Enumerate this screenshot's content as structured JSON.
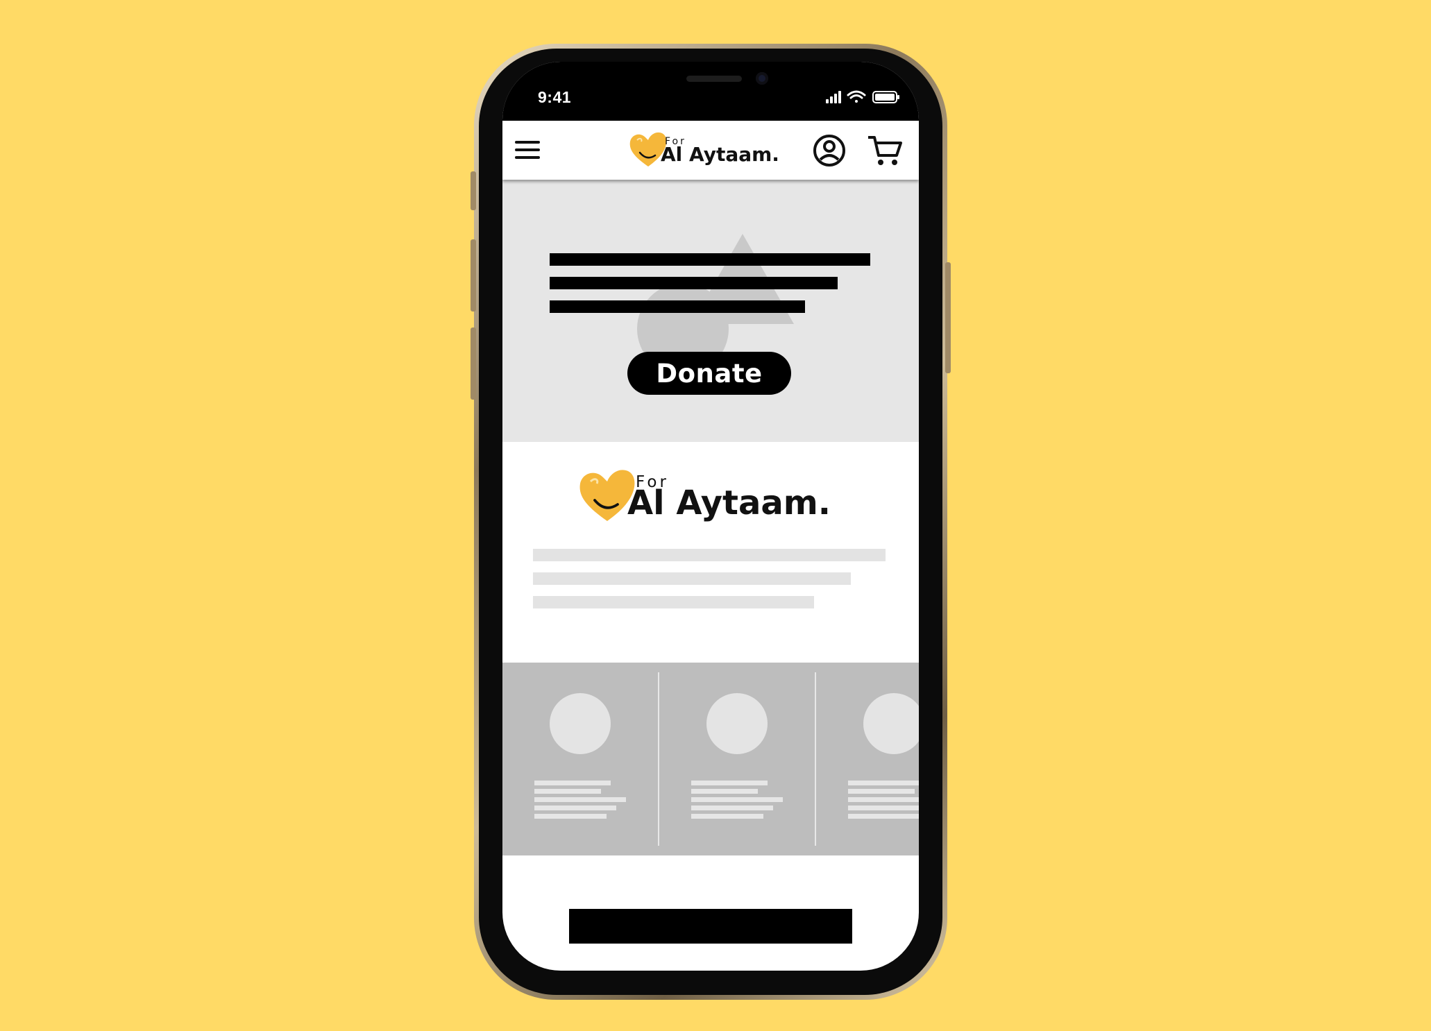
{
  "status_bar": {
    "time": "9:41"
  },
  "header": {
    "logo": {
      "for": "For",
      "name": "Al Aytaam."
    },
    "icons": [
      "menu-icon",
      "account-icon",
      "cart-icon"
    ]
  },
  "hero": {
    "donate_label": "Donate"
  },
  "about": {
    "logo": {
      "for": "For",
      "name": "Al Aytaam."
    }
  },
  "colors": {
    "background": "#FFDA66",
    "heart": "#F5B73A",
    "hero_bg": "#E6E6E6",
    "cards_bg": "#BDBDBD"
  }
}
